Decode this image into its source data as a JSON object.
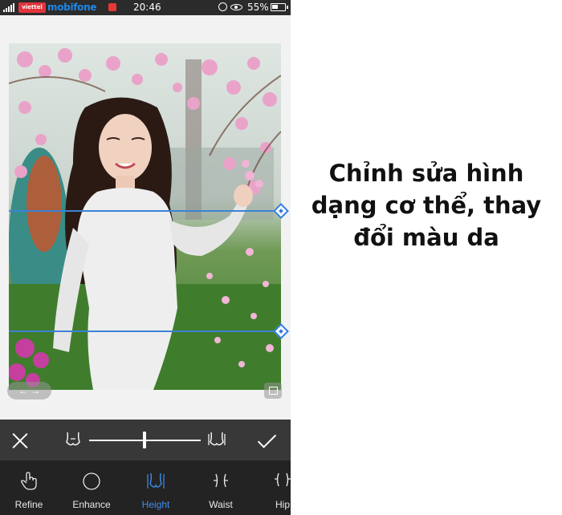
{
  "status_bar": {
    "carrier_logo": "viettel",
    "carrier": "mobifone",
    "time": "20:46",
    "battery": "55%",
    "icons": [
      "signal-icon",
      "alarm-icon",
      "eye-icon",
      "battery-icon"
    ]
  },
  "editor": {
    "compare_label": "← →",
    "fit_icon": "fit-screen-icon",
    "accent_color": "#3b82d6"
  },
  "slider": {
    "cancel_icon": "close-icon",
    "apply_icon": "check-icon",
    "value": 0.5
  },
  "toolbar": {
    "items": [
      {
        "label": "Refine",
        "icon": "hand-icon"
      },
      {
        "label": "Enhance",
        "icon": "circle-icon"
      },
      {
        "label": "Height",
        "icon": "height-body-icon",
        "active": true
      },
      {
        "label": "Waist",
        "icon": "waist-icon"
      },
      {
        "label": "Hip",
        "icon": "hip-icon"
      }
    ]
  },
  "caption": {
    "line1": "Chỉnh sửa hình",
    "line2": "dạng cơ thể, thay",
    "line3": "đổi màu da"
  }
}
